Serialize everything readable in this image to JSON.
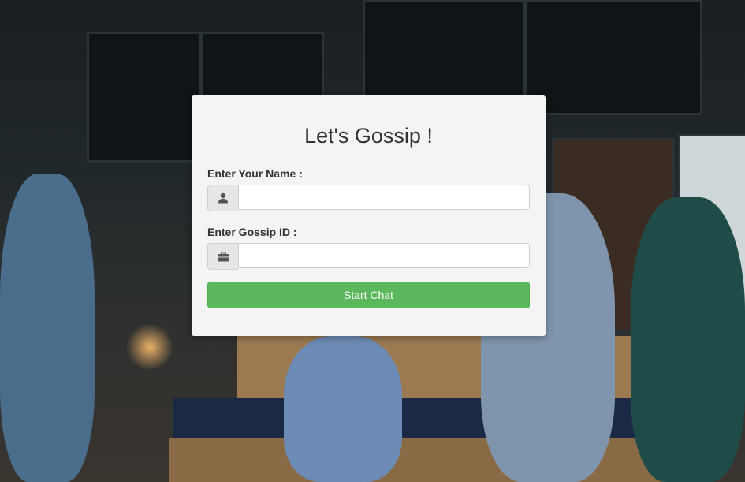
{
  "form": {
    "title": "Let's Gossip !",
    "name_label": "Enter Your Name :",
    "name_value": "",
    "name_placeholder": "",
    "gossip_label": "Enter Gossip ID :",
    "gossip_value": "",
    "gossip_placeholder": "",
    "submit_label": "Start Chat",
    "accent_color": "#5cb85c"
  },
  "icons": {
    "name_icon": "user-icon",
    "gossip_icon": "briefcase-icon"
  }
}
